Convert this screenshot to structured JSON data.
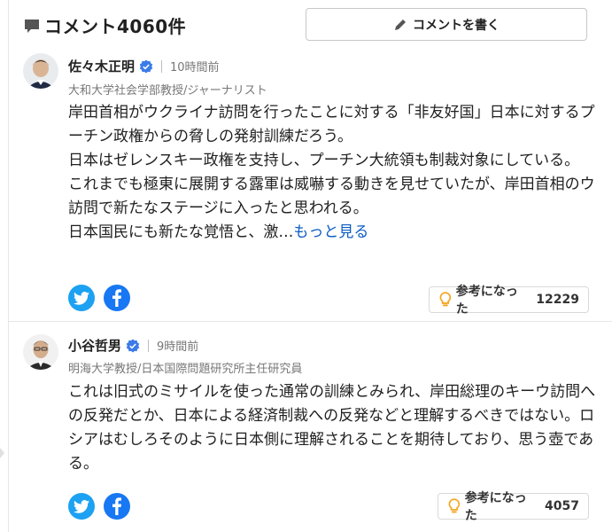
{
  "header": {
    "comment_count_label": "コメント4060件",
    "write_button_label": "コメントを書く"
  },
  "comments": [
    {
      "name": "佐々木正明",
      "time": "10時間前",
      "title": "大和大学社会学部教授/ジャーナリスト",
      "body_lines": [
        "岸田首相がウクライナ訪問を行ったことに対する「非友好国」日本に対するプーチン政権からの脅しの発射訓練だろう。",
        "日本はゼレンスキー政権を支持し、プーチン大統領も制裁対象にしている。",
        "これまでも極東に展開する露軍は威嚇する動きを見せていたが、岸田首相のウ訪問で新たなステージに入ったと思われる。",
        "日本国民にも新たな覚悟と、激…"
      ],
      "more_link": "もっと見る",
      "helpful_label": "参考になった",
      "helpful_count": "12229"
    },
    {
      "name": "小谷哲男",
      "time": "9時間前",
      "title": "明海大学教授/日本国際問題研究所主任研究員",
      "body_lines": [
        "これは旧式のミサイルを使った通常の訓練とみられ、岸田総理のキーウ訪問への反発だとか、日本による経済制裁への反発などと理解するべきではない。ロシアはむしろそのように日本側に理解されることを期待しており、思う壺である。"
      ],
      "helpful_label": "参考になった",
      "helpful_count": "4057"
    }
  ],
  "colors": {
    "twitter": "#1da1f2",
    "facebook": "#1877f2",
    "verified": "#3b7be8",
    "link": "#0c5cc4",
    "bulb": "#f5a623"
  },
  "icons": [
    "comment-bubble-icon",
    "pencil-icon",
    "verified-badge-icon",
    "twitter-icon",
    "facebook-icon",
    "lightbulb-icon"
  ]
}
